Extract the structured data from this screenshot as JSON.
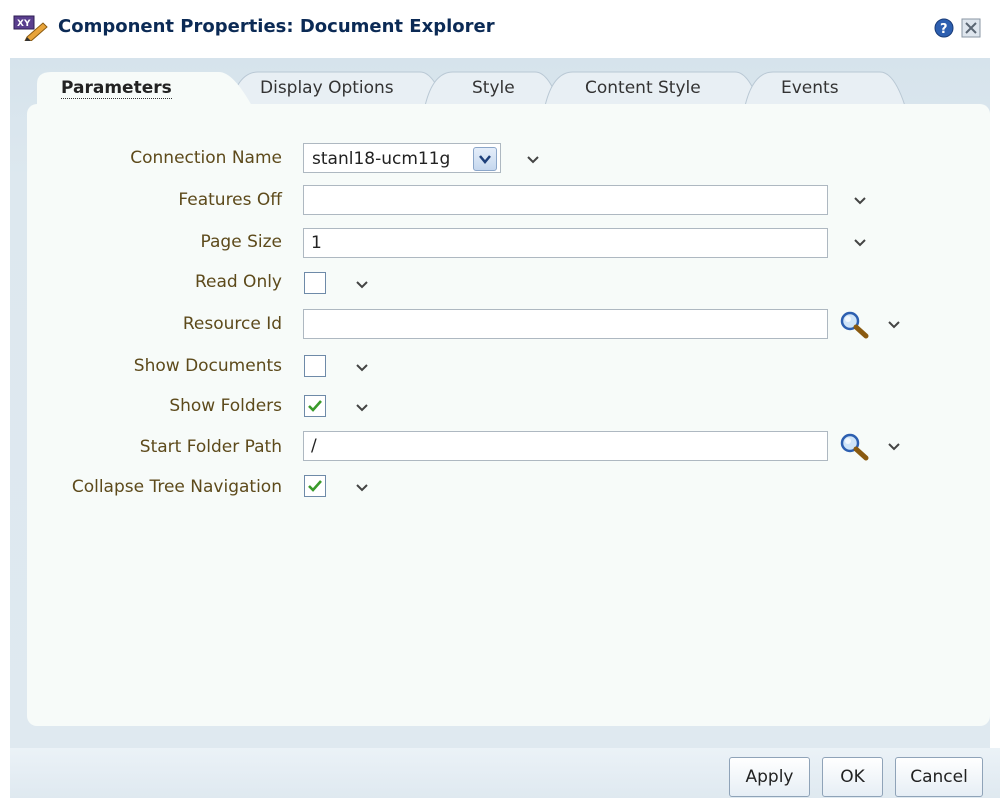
{
  "window": {
    "title": "Component Properties: Document Explorer",
    "app_icon": "xy-pencil-icon",
    "help_icon": "help-icon",
    "close_icon": "close-icon"
  },
  "tabs": [
    {
      "label": "Parameters",
      "active": true
    },
    {
      "label": "Display Options",
      "active": false
    },
    {
      "label": "Style",
      "active": false
    },
    {
      "label": "Content Style",
      "active": false
    },
    {
      "label": "Events",
      "active": false
    }
  ],
  "fields": {
    "connection_name": {
      "label": "Connection Name",
      "value": "stanl18-ucm11g"
    },
    "features_off": {
      "label": "Features Off",
      "value": ""
    },
    "page_size": {
      "label": "Page Size",
      "value": "1"
    },
    "read_only": {
      "label": "Read Only",
      "checked": false
    },
    "resource_id": {
      "label": "Resource Id",
      "value": ""
    },
    "show_documents": {
      "label": "Show Documents",
      "checked": false
    },
    "show_folders": {
      "label": "Show Folders",
      "checked": true
    },
    "start_folder_path": {
      "label": "Start Folder Path",
      "value": "/"
    },
    "collapse_tree_navigation": {
      "label": "Collapse Tree Navigation",
      "checked": true
    }
  },
  "buttons": {
    "apply": "Apply",
    "ok": "OK",
    "cancel": "Cancel"
  },
  "colors": {
    "title": "#0b2a55",
    "label": "#5d4a1b",
    "checkmark": "#3a9a2a",
    "panel": "#f7fbf9",
    "tab_strip": "#d6e3ec"
  }
}
